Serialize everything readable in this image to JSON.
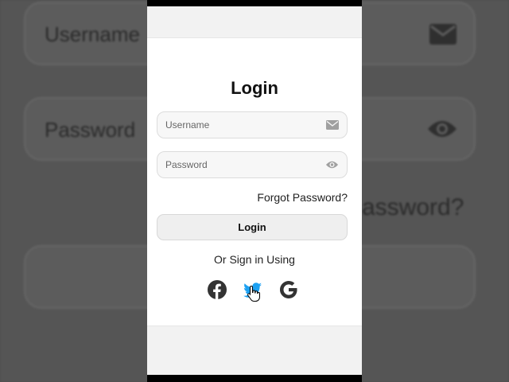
{
  "background": {
    "username_placeholder": "Username",
    "password_placeholder": "Password",
    "forgot_fragment": "assword?"
  },
  "login": {
    "title": "Login",
    "username_placeholder": "Username",
    "password_placeholder": "Password",
    "forgot_label": "Forgot Password?",
    "submit_label": "Login",
    "social_prompt": "Or Sign in Using"
  },
  "social": [
    {
      "icon": "facebook-icon",
      "color": "#333333"
    },
    {
      "icon": "twitter-icon",
      "color": "#1DA1F2"
    },
    {
      "icon": "google-icon",
      "color": "#333333"
    }
  ],
  "colors": {
    "twitter_blue": "#1DA1F2",
    "card_bg": "#ffffff",
    "field_bg": "#f7f7f7",
    "icon_gray": "#a0a0a0"
  }
}
